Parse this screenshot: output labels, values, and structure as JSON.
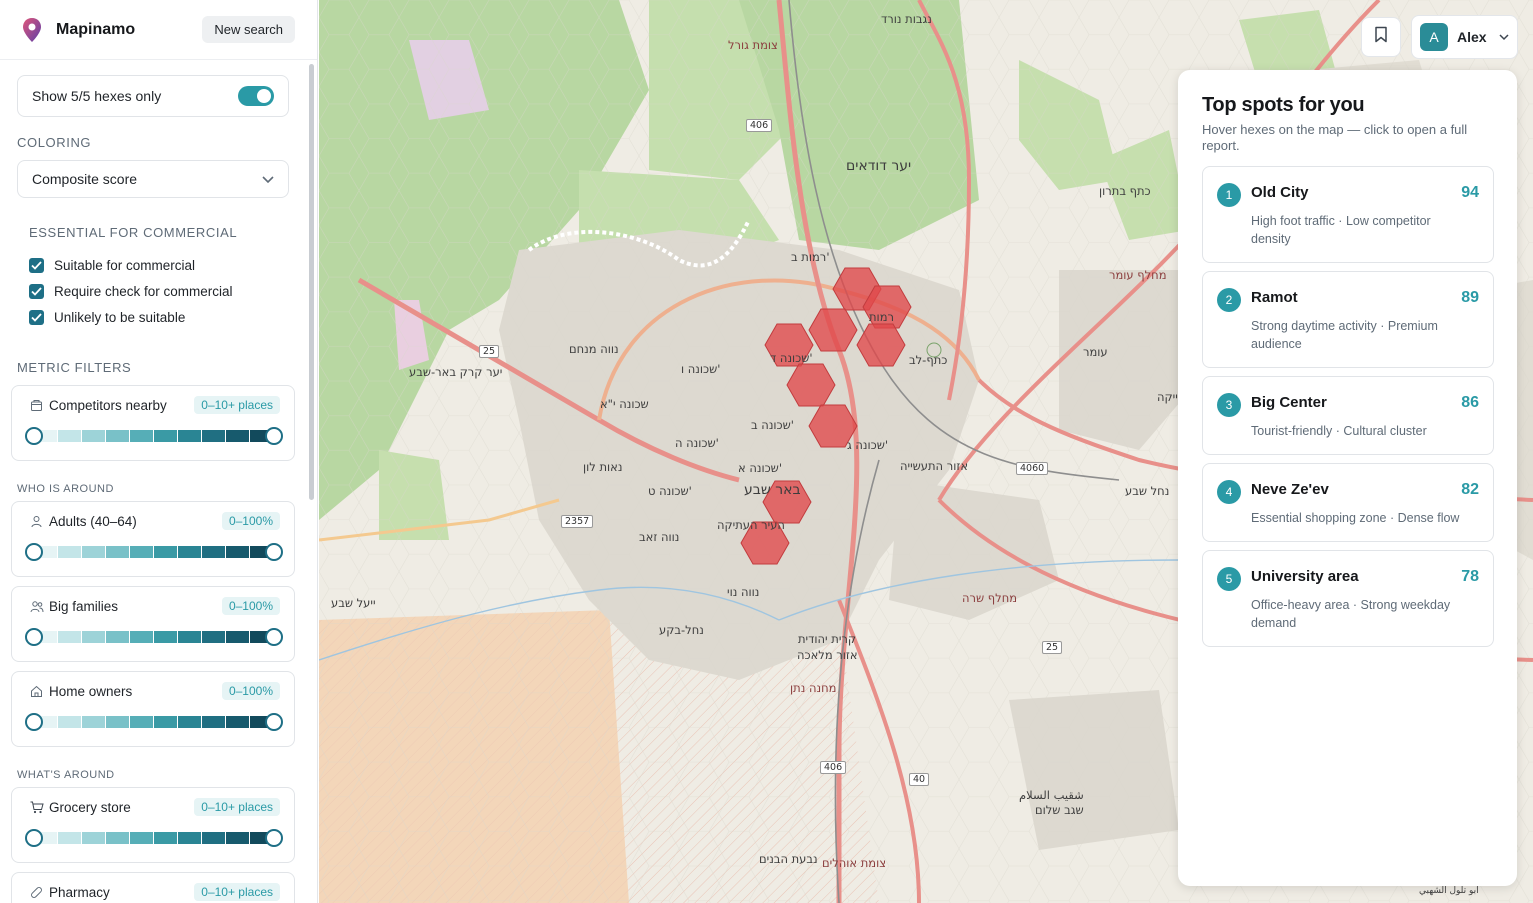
{
  "app": {
    "brand": "Mapinamo",
    "new_search_label": "New search"
  },
  "sidebar": {
    "show_toggle_label": "Show 5/5 hexes only",
    "show_toggle_on": true,
    "coloring_label": "COLORING",
    "coloring_value": "Composite score",
    "essential_label": "ESSENTIAL FOR COMMERCIAL",
    "essential_items": [
      {
        "label": "Suitable for commercial",
        "checked": true
      },
      {
        "label": "Require check for commercial",
        "checked": true
      },
      {
        "label": "Unlikely to be suitable",
        "checked": true
      }
    ],
    "metric_filters_label": "METRIC FILTERS",
    "competitors": {
      "label": "Competitors nearby",
      "range": "0–10+ places",
      "icon": "store-icon",
      "min": 0,
      "max": 1
    },
    "who_label": "WHO IS AROUND",
    "adults": {
      "label": "Adults (40–64)",
      "range": "0–100%",
      "icon": "person-icon",
      "min": 0,
      "max": 1
    },
    "families": {
      "label": "Big families",
      "range": "0–100%",
      "icon": "people-icon",
      "min": 0,
      "max": 1
    },
    "owners": {
      "label": "Home owners",
      "range": "0–100%",
      "icon": "home-icon",
      "min": 0,
      "max": 1
    },
    "what_label": "WHAT'S AROUND",
    "grocery": {
      "label": "Grocery store",
      "range": "0–10+ places",
      "icon": "cart-icon",
      "min": 0,
      "max": 1
    },
    "pharmacy": {
      "label": "Pharmacy",
      "range": "0–10+ places",
      "icon": "pill-icon",
      "min": 0,
      "max": 1
    }
  },
  "user": {
    "initial": "A",
    "name": "Alex"
  },
  "panel": {
    "title": "Top spots for you",
    "subtitle": "Hover hexes on the map — click to open a full report.",
    "spots": [
      {
        "rank": "1",
        "name": "Old City",
        "score": "94",
        "desc": "High foot traffic · Low competitor density"
      },
      {
        "rank": "2",
        "name": "Ramot",
        "score": "89",
        "desc": "Strong daytime activity · Premium audience"
      },
      {
        "rank": "3",
        "name": "Big Center",
        "score": "86",
        "desc": "Tourist-friendly · Cultural cluster"
      },
      {
        "rank": "4",
        "name": "Neve Ze'ev",
        "score": "82",
        "desc": "Essential shopping zone · Dense flow"
      },
      {
        "rank": "5",
        "name": "University area",
        "score": "78",
        "desc": "Office-heavy area · Strong weekday demand"
      }
    ]
  },
  "map": {
    "labels": [
      {
        "text": "יער דודאים"
      },
      {
        "text": "רמות ב'"
      },
      {
        "text": "רמות"
      },
      {
        "text": "נווה מנחם"
      },
      {
        "text": "שכונה ו'"
      },
      {
        "text": "שכונה ד'"
      },
      {
        "text": "שכונה י\"א"
      },
      {
        "text": "שכונה ב'"
      },
      {
        "text": "שכונה ה'"
      },
      {
        "text": "שכונה ג'"
      },
      {
        "text": "נאות לון"
      },
      {
        "text": "שכונה א'"
      },
      {
        "text": "שכונה ט'"
      },
      {
        "text": "באר שבע"
      },
      {
        "text": "העיר העתיקה"
      },
      {
        "text": "נווה זאב"
      },
      {
        "text": "נווה נוי"
      },
      {
        "text": "נחל-בקע"
      },
      {
        "text": "קרית יהודית"
      },
      {
        "text": "אזור מלאכה"
      },
      {
        "text": "אזור התעשייה"
      },
      {
        "text": "עומר"
      },
      {
        "text": "מחנה נתן"
      },
      {
        "text": "נבעת הבנים"
      },
      {
        "text": "צומת אוהלים"
      },
      {
        "text": "شقيب السلام"
      },
      {
        "text": "שגב שלום"
      },
      {
        "text": "כתף-לב"
      },
      {
        "text": "יער קרק באר-שבע"
      },
      {
        "text": "נגבות נורד"
      },
      {
        "text": "צומת גורל"
      },
      {
        "text": "כתף בתרון"
      },
      {
        "text": "מחלף עומר"
      },
      {
        "text": "מחלף שרה"
      },
      {
        "text": "נחל שבע"
      },
      {
        "text": "ייעל שבע"
      },
      {
        "text": "ابو تلول الشهبي"
      },
      {
        "text": "ייקה"
      }
    ],
    "road_numbers": [
      "406",
      "25",
      "2357",
      "4060",
      "406",
      "40",
      "25"
    ]
  },
  "colors": {
    "accent": "#2a9aa6",
    "dark_accent": "#1e6f86",
    "hex_fill": "#e0484a"
  }
}
